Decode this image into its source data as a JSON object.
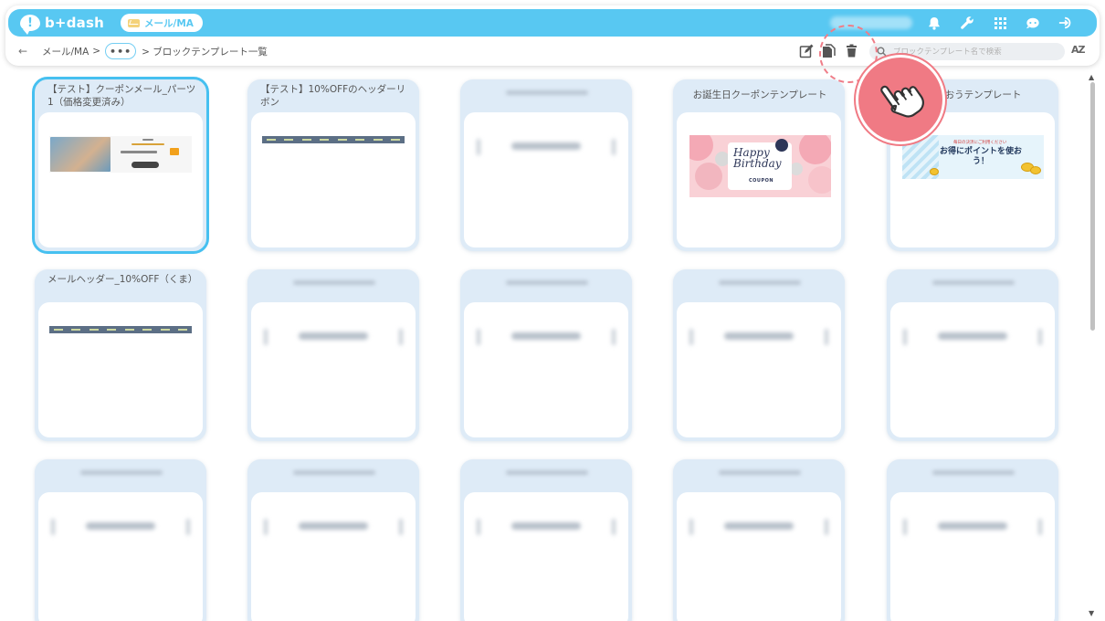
{
  "app": {
    "logo_text": "b+dash",
    "logo_glyph": "!",
    "module_label": "メール/MA"
  },
  "topbar_icons": [
    "bell-icon",
    "wrench-icon",
    "grid-icon",
    "chat-icon",
    "logout-icon"
  ],
  "breadcrumb": {
    "back": "←",
    "root": "メール/MA",
    "sep": ">",
    "ellipsis": "•••",
    "current": "> ブロックテンプレート一覧"
  },
  "actions": [
    "edit-icon",
    "copy-icon",
    "trash-icon"
  ],
  "search": {
    "placeholder": "ブロックテンプレート名で検索"
  },
  "sort_label": "AZ",
  "cards": [
    {
      "title": "【テスト】クーポンメール_パーツ1（価格変更済み）",
      "preview": "coupon",
      "selected": true
    },
    {
      "title": "【テスト】10%OFFのヘッダーリボン",
      "preview": "ribbon"
    },
    {
      "title": "",
      "preview": "blurred"
    },
    {
      "title": "お誕生日クーポンテンプレート",
      "preview": "birthday"
    },
    {
      "title": "ト使おうテンプレート",
      "preview": "points"
    },
    {
      "title": "メールヘッダー_10%OFF（くま）",
      "preview": "ribbon"
    },
    {
      "title": "",
      "preview": "blurred"
    },
    {
      "title": "",
      "preview": "blurred"
    },
    {
      "title": "",
      "preview": "blurred"
    },
    {
      "title": "",
      "preview": "blurred"
    },
    {
      "title": "",
      "preview": "blurred"
    },
    {
      "title": "",
      "preview": "blurred"
    },
    {
      "title": "",
      "preview": "blurred"
    },
    {
      "title": "",
      "preview": "blurred"
    },
    {
      "title": "",
      "preview": "blurred"
    }
  ],
  "previews": {
    "birthday_line1": "Happy",
    "birthday_line2": "Birthday",
    "birthday_coupon": "COUPON",
    "points_small": "毎日の決済にご利用ください",
    "points_main": "お得にポイントを使おう！"
  },
  "colors": {
    "accent": "#58c8f2",
    "card_bg": "#deebf7",
    "selected_outline": "#46c0f0",
    "pointer": "#f07a84"
  }
}
